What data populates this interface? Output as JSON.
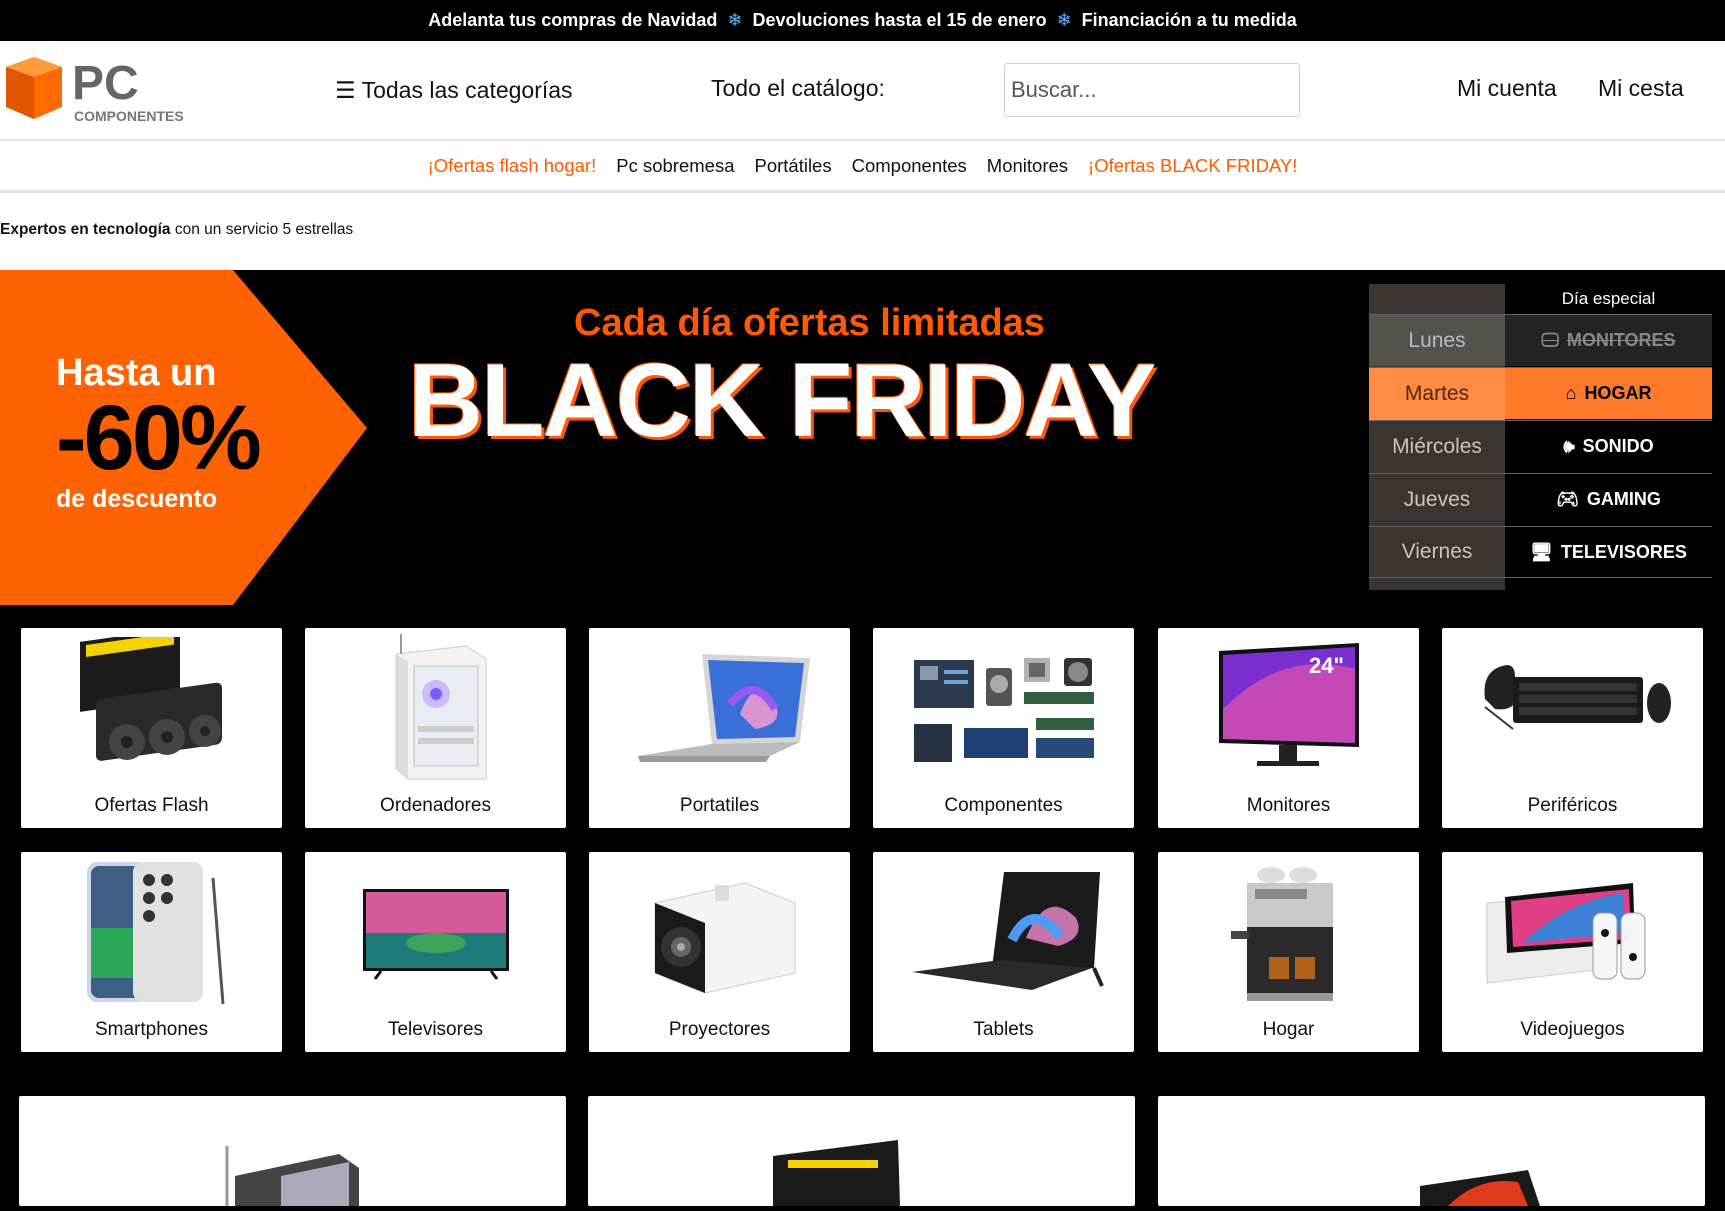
{
  "promo": {
    "item1": "Adelanta tus compras de Navidad",
    "item2": "Devoluciones hasta el 15 de enero",
    "item3": "Financiación a tu medida",
    "separator_icon": "snowflake-icon"
  },
  "header": {
    "logo_text": "PC",
    "logo_sub": "COMPONENTES",
    "categories_label": "☰ Todas las categorías",
    "catalog_label": "Todo el catálogo:",
    "search_placeholder": "Buscar...",
    "account_label": "Mi cuenta",
    "cart_label": "Mi cesta"
  },
  "nav": {
    "items": [
      {
        "label": "¡Ofertas flash hogar!",
        "highlight": true
      },
      {
        "label": "Pc sobremesa",
        "highlight": false
      },
      {
        "label": "Portátiles",
        "highlight": false
      },
      {
        "label": "Componentes",
        "highlight": false
      },
      {
        "label": "Monitores",
        "highlight": false
      },
      {
        "label": "¡Ofertas BLACK FRIDAY!",
        "highlight": true
      }
    ]
  },
  "tagline": {
    "bold": "Expertos en tecnología",
    "rest": " con un servicio 5 estrellas"
  },
  "banner": {
    "discount_line1": "Hasta un",
    "discount_line2": "-60%",
    "discount_line3": "de descuento",
    "subtitle": "Cada día ofertas limitadas",
    "title": "BLACK FRIDAY",
    "schedule_header": "Día especial",
    "schedule": [
      {
        "day": "Lunes",
        "category": "MONITORES",
        "icon": "monitor-icon",
        "state": "past"
      },
      {
        "day": "Martes",
        "category": "HOGAR",
        "icon": "home-icon",
        "state": "active"
      },
      {
        "day": "Miércoles",
        "category": "SONIDO",
        "icon": "speaker-icon",
        "state": "upcoming"
      },
      {
        "day": "Jueves",
        "category": "GAMING",
        "icon": "gamepad-icon",
        "state": "upcoming"
      },
      {
        "day": "Viernes",
        "category": "TELEVISORES",
        "icon": "tv-icon",
        "state": "upcoming"
      }
    ],
    "accent_color": "#ff5a00"
  },
  "categories": [
    {
      "label": "Ofertas Flash",
      "icon": "graphics-card-icon"
    },
    {
      "label": "Ordenadores",
      "icon": "pc-tower-icon"
    },
    {
      "label": "Portatiles",
      "icon": "laptop-icon"
    },
    {
      "label": "Componentes",
      "icon": "components-icon"
    },
    {
      "label": "Monitores",
      "icon": "monitor-icon"
    },
    {
      "label": "Periféricos",
      "icon": "keyboard-mouse-icon"
    },
    {
      "label": "Smartphones",
      "icon": "smartphone-icon"
    },
    {
      "label": "Televisores",
      "icon": "tv-icon"
    },
    {
      "label": "Proyectores",
      "icon": "projector-icon"
    },
    {
      "label": "Tablets",
      "icon": "tablet-icon"
    },
    {
      "label": "Hogar",
      "icon": "coffee-machine-icon"
    },
    {
      "label": "Videojuegos",
      "icon": "console-icon"
    }
  ]
}
